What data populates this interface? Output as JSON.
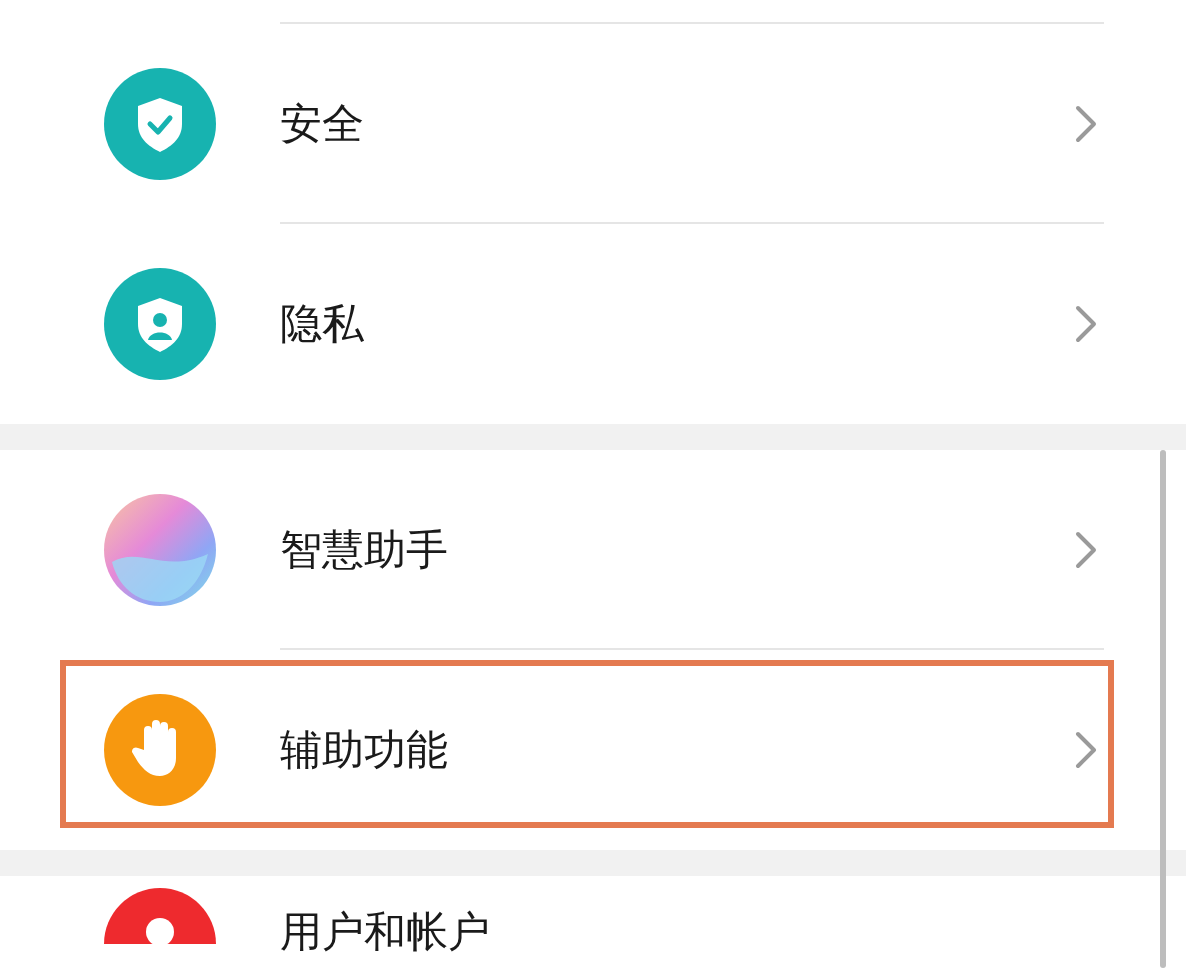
{
  "groups": [
    {
      "items": [
        {
          "label": "安全",
          "kind": "shield-check",
          "highlighted": false
        },
        {
          "label": "隐私",
          "kind": "shield-person",
          "highlighted": false
        }
      ]
    },
    {
      "items": [
        {
          "label": "智慧助手",
          "kind": "orb",
          "highlighted": false
        },
        {
          "label": "辅助功能",
          "kind": "hand",
          "highlighted": true
        }
      ]
    },
    {
      "items": [
        {
          "label": "用户和帐户",
          "kind": "person",
          "highlighted": false
        }
      ]
    }
  ]
}
